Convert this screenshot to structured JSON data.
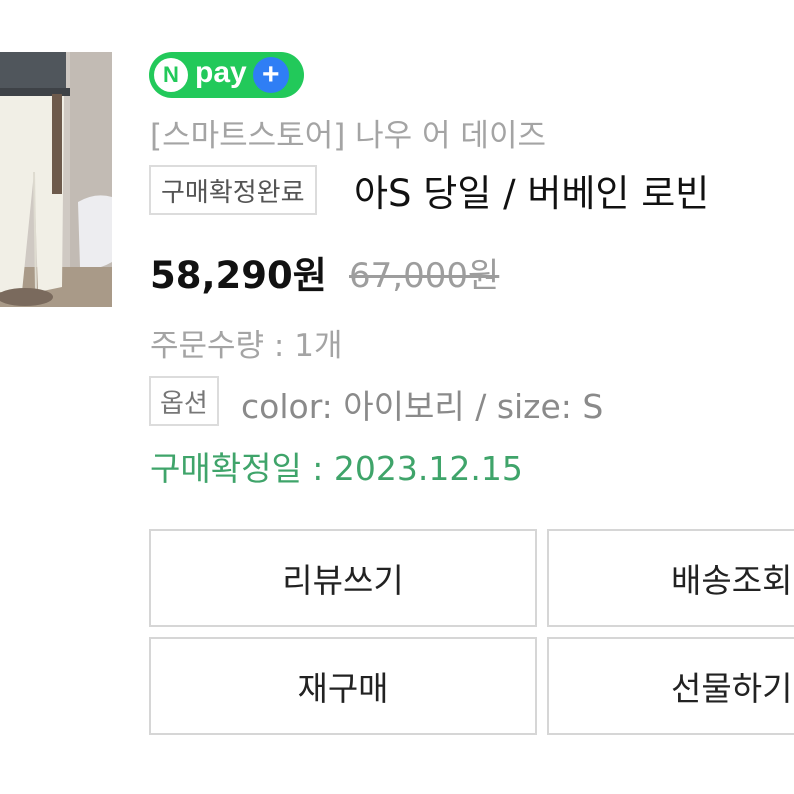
{
  "npay": {
    "n_mark": "N",
    "label": "pay",
    "plus": "+",
    "colors": {
      "green": "#22c95a",
      "blue": "#2f7ef5"
    }
  },
  "store_name": "[스마트스토어] 나우 어 데이즈",
  "status_badge": "구매확정완료",
  "product_title": "아S 당일 / 버베인 로빈 ",
  "price": "58,290원",
  "original_price": "67,000원",
  "quantity": "주문수량 : 1개",
  "option_badge": "옵션",
  "option_value": "color: 아이보리 / size: S",
  "confirm_date": "구매확정일 : 2023.12.15",
  "buttons": {
    "review": "리뷰쓰기",
    "delivery": "배송조회",
    "rebuy": "재구매",
    "gift": "선물하기"
  },
  "colors": {
    "confirm_green": "#3fa46a",
    "muted_text": "#a4a4a4",
    "border": "#d6d6d6"
  }
}
